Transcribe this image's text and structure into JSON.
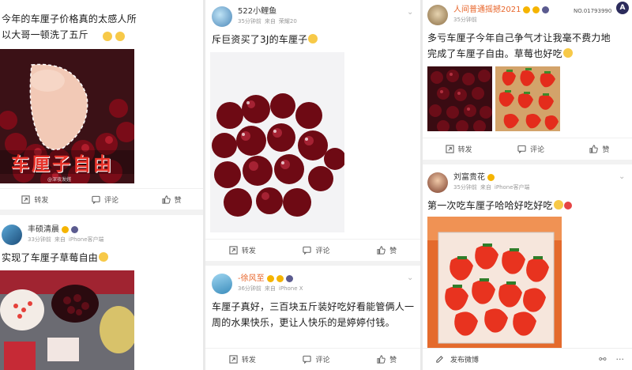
{
  "col1": {
    "top_text": "今年的车厘子价格真的太感人所以大哥一顿洗了五斤",
    "banner": "车厘子自由",
    "watermark": "@深夜发媸",
    "actions": {
      "repost": "转发",
      "comment": "评论",
      "like": "赞"
    },
    "post2": {
      "name": "丰硕清晨",
      "meta_time": "33分钟前",
      "meta_from": "来自",
      "meta_device": "iPhone客户端",
      "text": "实现了车厘子草莓自由"
    }
  },
  "col2": {
    "post1": {
      "name": "522小鲤鱼",
      "meta_time": "35分钟前",
      "meta_from": "来自",
      "meta_device": "荣耀20",
      "text": "斥巨资买了3J的车厘子",
      "actions": {
        "repost": "转发",
        "comment": "评论",
        "like": "赞"
      }
    },
    "post2": {
      "name": "-徐风至",
      "meta_time": "36分钟前",
      "meta_from": "来自",
      "meta_device": "iPhone X",
      "text": "车厘子真好，三百块五斤装好吃好看能管俩人一周的水果快乐，更让人快乐的是婷婷付钱。",
      "actions": {
        "repost": "转发",
        "comment": "评论",
        "like": "赞"
      }
    }
  },
  "col3": {
    "post1": {
      "name": "人间普通摇撼2021",
      "id_text": "NO.01793990",
      "meta_time": "35分钟前",
      "text": "多亏车厘子今年自己争气才让我毫不费力地完成了车厘子自由。草莓也好吃",
      "actions": {
        "repost": "转发",
        "comment": "评论",
        "like": "赞"
      }
    },
    "post2": {
      "name": "刘富贵花",
      "meta_time": "35分钟前",
      "meta_from": "来自",
      "meta_device": "iPhone客户端",
      "text": "第一次吃车厘子哈哈好吃好吃"
    },
    "bottombar": {
      "compose": "发布微博"
    }
  },
  "colors": {
    "cherry": "#8b0f1e",
    "strawberry": "#e8331f",
    "vip_name": "#e8662b",
    "banner_text": "#e8332a"
  }
}
